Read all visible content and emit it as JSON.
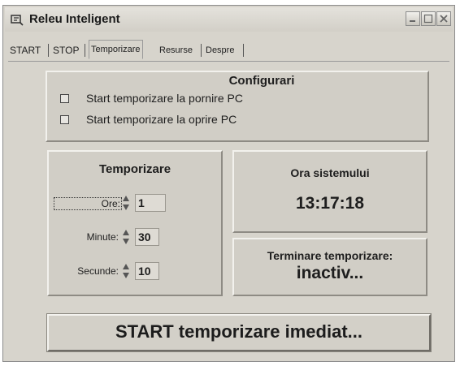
{
  "window": {
    "title": "Releu Inteligent",
    "icon": "relay-app-icon",
    "buttons": [
      "minimize",
      "maximize",
      "close"
    ]
  },
  "tabs": [
    {
      "label": "START",
      "active": false
    },
    {
      "label": "STOP",
      "active": false
    },
    {
      "label": "Temporizare",
      "active": true
    },
    {
      "label": "Resurse",
      "active": false
    },
    {
      "label": "Despre",
      "active": false
    }
  ],
  "config": {
    "title": "Configurari",
    "options": [
      {
        "label": "Start temporizare la pornire PC",
        "checked": false
      },
      {
        "label": "Start temporizare la oprire PC",
        "checked": false
      }
    ]
  },
  "timer": {
    "title": "Temporizare",
    "hours_label": "Ore:",
    "hours_value": "1",
    "minutes_label": "Minute:",
    "minutes_value": "30",
    "seconds_label": "Secunde:",
    "seconds_value": "10"
  },
  "clock": {
    "title": "Ora sistemului",
    "time": "13:17:18"
  },
  "status": {
    "title": "Terminare temporizare:",
    "value": "inactiv..."
  },
  "action": {
    "label": "START temporizare imediat..."
  },
  "colors": {
    "window_bg": "#d7d4cc",
    "panel_bg": "#d1cec6"
  }
}
